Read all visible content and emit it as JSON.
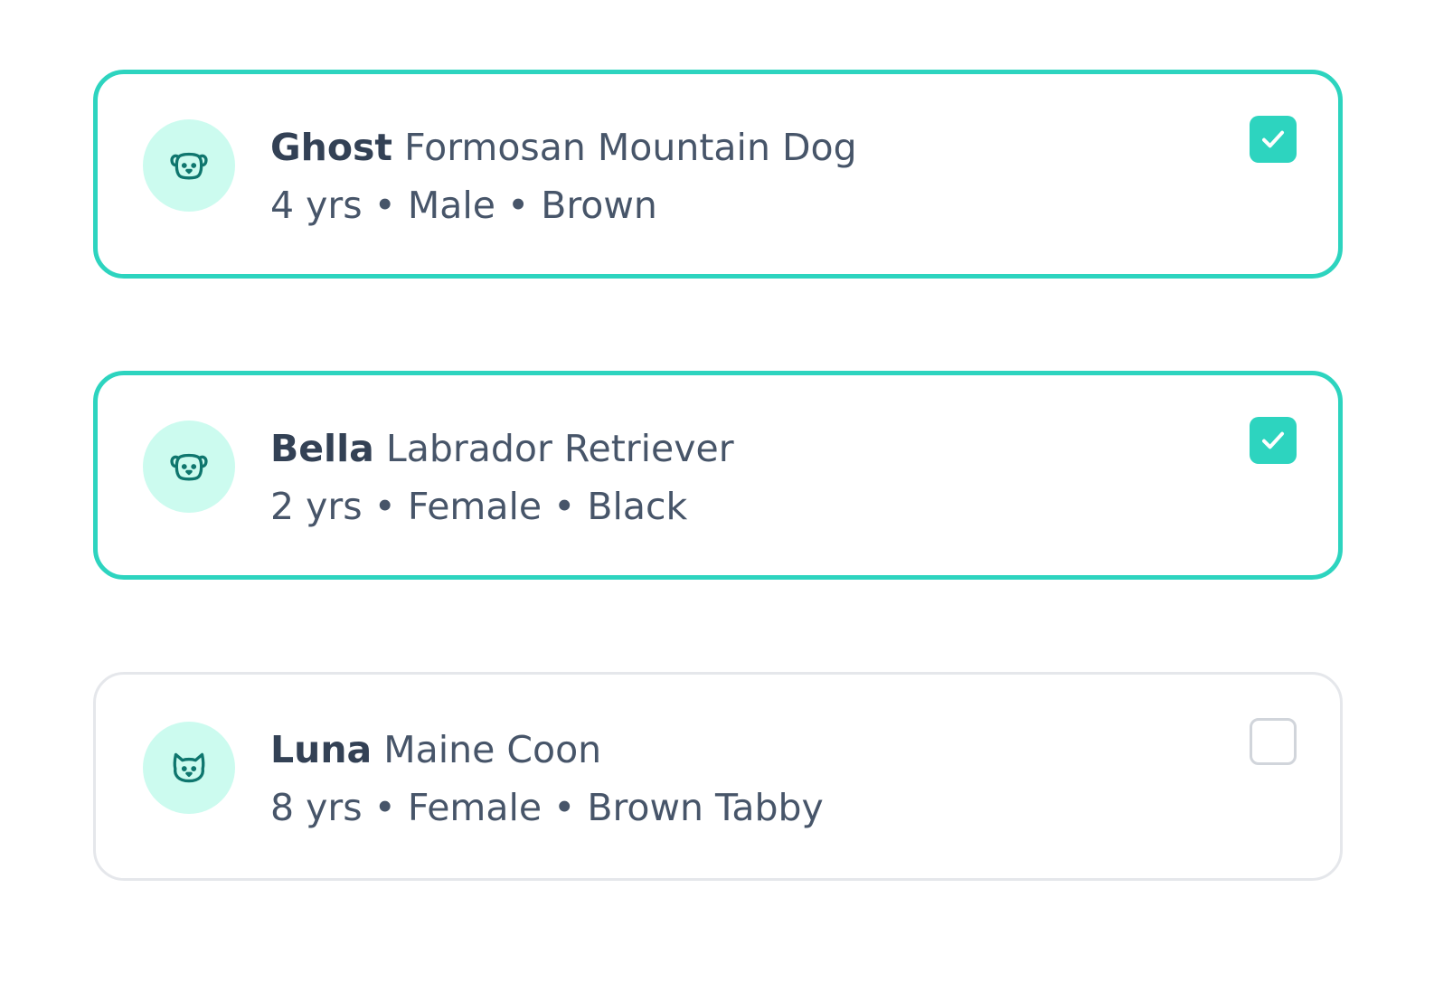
{
  "theme": {
    "accent": "#2dd4bf",
    "avatar_bg": "#ccfbef",
    "icon_color": "#0f766e",
    "border_unselected": "#e5e7eb",
    "text_primary": "#334155",
    "text_secondary": "#475569"
  },
  "pets": [
    {
      "name": "Ghost",
      "breed": "Formosan Mountain Dog",
      "details": "4 yrs • Male • Brown",
      "species_icon": "dog-icon",
      "selected": true
    },
    {
      "name": "Bella",
      "breed": "Labrador Retriever",
      "details": "2 yrs • Female • Black",
      "species_icon": "dog-icon",
      "selected": true
    },
    {
      "name": "Luna",
      "breed": "Maine Coon",
      "details": "8 yrs • Female • Brown Tabby",
      "species_icon": "cat-icon",
      "selected": false
    }
  ]
}
